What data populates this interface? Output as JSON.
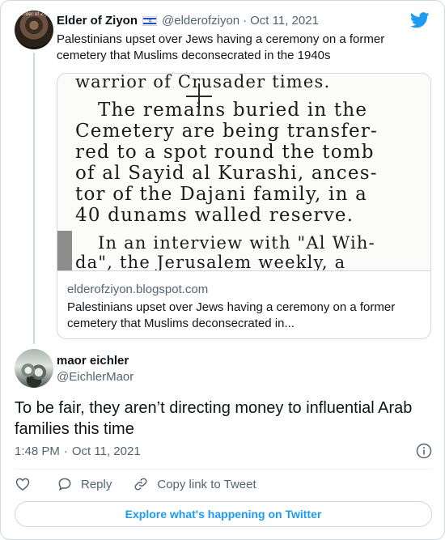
{
  "parent_tweet": {
    "avatar_tag": "Elder of Ziyon",
    "author_name": "Elder of Ziyon",
    "flag_icon": "israel-flag-icon",
    "handle": "@elderofziyon",
    "separator": "·",
    "date": "Oct 11, 2021",
    "text": "Palestinians upset over Jews having a ceremony on a former cemetery that Muslims deconsecrated in the 1940s"
  },
  "link_card": {
    "image_lines": [
      "warrior of Crusader times.",
      "The remains  buried in  the",
      "Cemetery are being  transfer-",
      "red to a spot round the tomb",
      "of al Sayid al Kurashi, ances-",
      "tor of the Dajani family, in a",
      "40 dunams walled  reserve.",
      "In an interview with \"Al Wih-",
      "da\", the Jerusalem  weekly,  a"
    ],
    "domain": "elderofziyon.blogspot.com",
    "title": "Palestinians upset over Jews having a ceremony on a former cemetery that Muslims deconsecrated in..."
  },
  "reply_tweet": {
    "author_name": "maor eichler",
    "handle": "@EichlerMaor",
    "text": "To be fair, they aren’t directing money to influential Arab families this time",
    "time": "1:48 PM",
    "separator": "·",
    "date": "Oct 11, 2021"
  },
  "actions": {
    "like_icon": "heart-icon",
    "reply_label": "Reply",
    "copy_link_label": "Copy link to Tweet"
  },
  "explore_button": {
    "label": "Explore what's happening on Twitter"
  },
  "colors": {
    "accent": "#1d9bf0",
    "text_primary": "#0f1419",
    "text_secondary": "#536471",
    "border": "#cfd9de"
  }
}
